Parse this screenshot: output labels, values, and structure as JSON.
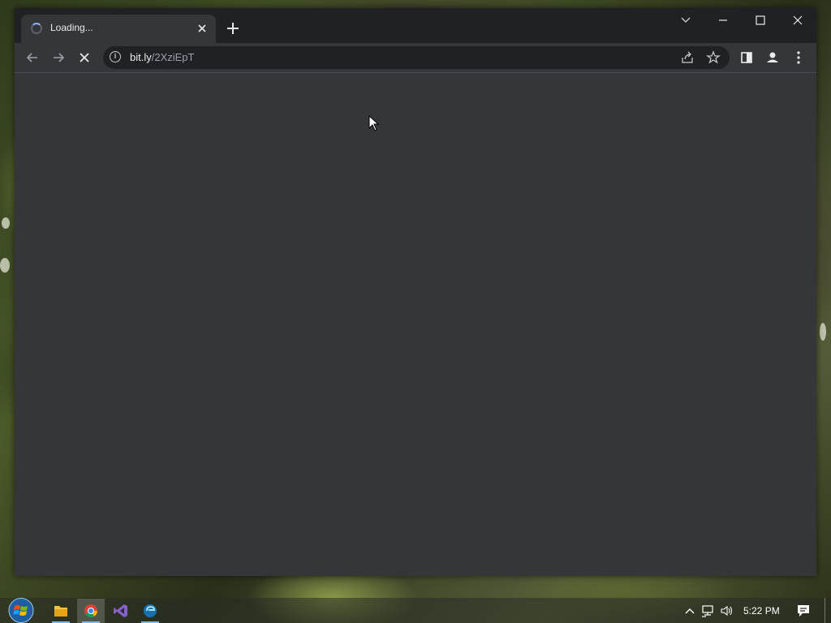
{
  "browser": {
    "tab": {
      "title": "Loading..."
    },
    "new_tab_label": "+",
    "window_controls": {
      "tab_search": "chevron-down-icon",
      "minimize": "minimize-icon",
      "maximize": "maximize-icon",
      "close": "close-icon"
    },
    "toolbar": {
      "url_host": "bit.ly",
      "url_path": "/2XziEpT",
      "back": "arrow-left-icon",
      "forward": "arrow-right-icon",
      "stop": "stop-icon",
      "share": "share-icon",
      "bookmark": "star-icon",
      "side_panel": "side-panel-icon",
      "profile": "profile-icon",
      "menu": "kebab-menu-icon"
    }
  },
  "taskbar": {
    "apps": [
      {
        "name": "file-explorer",
        "active": false
      },
      {
        "name": "chrome",
        "active": true
      },
      {
        "name": "visual-studio",
        "active": false
      },
      {
        "name": "edge-beta",
        "active": false
      }
    ],
    "clock": "5:22 PM"
  },
  "colors": {
    "titlebar": "#202124",
    "page_background": "#35363a",
    "omnibox": "#202124",
    "text": "#e8eaed"
  }
}
